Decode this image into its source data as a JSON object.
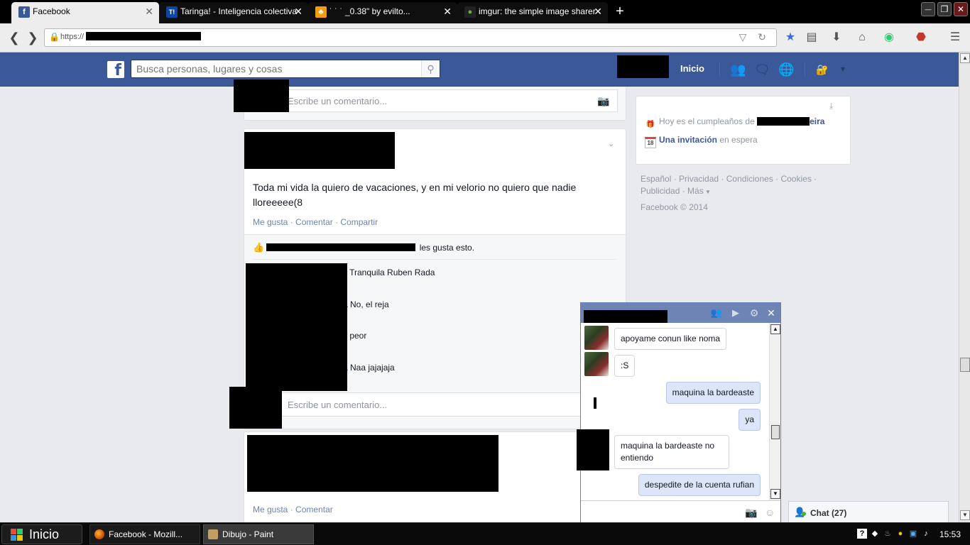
{
  "browser": {
    "tabs": [
      {
        "title": "Facebook",
        "favicon": "facebook-favicon",
        "color": "#3b5998",
        "glyph": "f",
        "active": true
      },
      {
        "title": "Taringa! - Inteligencia colectiva",
        "favicon": "taringa-favicon",
        "color": "#0d47a1",
        "glyph": "T!",
        "active": false
      },
      {
        "title": "˙ ˙ ˙          _0.38\" by evilto...",
        "favicon": "audio-favicon",
        "color": "#f39c12",
        "glyph": "♣",
        "active": false
      },
      {
        "title": "imgur: the simple image sharer",
        "favicon": "imgur-favicon",
        "color": "#6ab04c",
        "glyph": "●",
        "active": false
      }
    ],
    "new_tab": "+",
    "url_prefix": "https://",
    "window_controls": {
      "minimize": "—",
      "restore": "❐",
      "close": "✕"
    }
  },
  "facebook": {
    "search_placeholder": "Busca personas, lugares y cosas",
    "home_label": "Inicio",
    "comment_placeholder": "Escribe un comentario...",
    "post": {
      "text": "Toda mi vida la quiero de vacaciones, y en mi velorio no quiero que nadie lloreeeee(8",
      "actions": {
        "like": "Me gusta",
        "comment": "Comentar",
        "share": "Compartir"
      },
      "likes_suffix": "les gusta esto.",
      "comments": [
        {
          "text": "z Tranquila Ruben Rada"
        },
        {
          "text": "á No, el reja"
        },
        {
          "text": "z peor"
        },
        {
          "text": "á Naa jajajaja"
        }
      ]
    },
    "post2_actions": {
      "like": "Me gusta",
      "comment": "Comentar"
    },
    "right": {
      "birthday_prefix": "Hoy es el cumpleaños de",
      "birthday_name_tail": "eira",
      "invite_link": "Una invitación",
      "invite_suffix": "en espera",
      "calendar_day": "18"
    },
    "footer": {
      "links": [
        "Español",
        "Privacidad",
        "Condiciones",
        "Cookies",
        "Publicidad",
        "Más"
      ],
      "copyright": "Facebook © 2014"
    }
  },
  "chat": {
    "messages": [
      {
        "from": "friend",
        "text": "apoyame conun like noma"
      },
      {
        "from": "friend",
        "text": ":S"
      },
      {
        "from": "me",
        "text": "maquina la bardeaste"
      },
      {
        "from": "me",
        "text": "ya"
      },
      {
        "from": "friend",
        "text": "maquina la bardeaste no entiendo"
      },
      {
        "from": "me",
        "text": "despedite de la cuenta rufian"
      }
    ],
    "tab_label": "Chat (27)"
  },
  "taskbar": {
    "start_label": "Inicio",
    "items": [
      {
        "label": "Facebook - Mozill...",
        "icon": "firefox-icon"
      },
      {
        "label": "Dibujo - Paint",
        "icon": "paint-icon"
      }
    ],
    "clock": "15:53"
  },
  "colors": {
    "facebook_blue": "#3b5998",
    "link": "#6d84b4",
    "chat_header": "#6d84b4",
    "page_bg": "#e9eaed"
  }
}
